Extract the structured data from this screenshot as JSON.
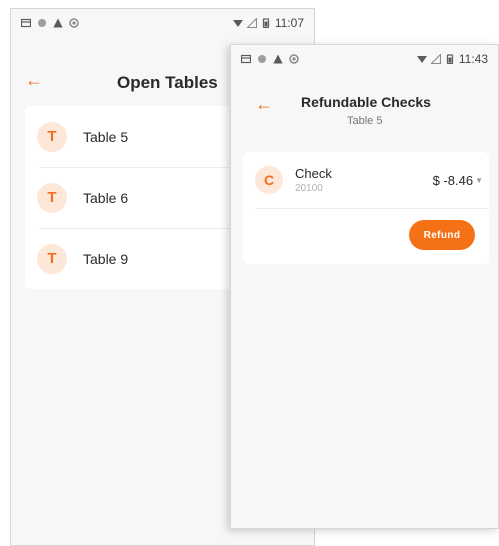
{
  "colors": {
    "accent": "#f26f21",
    "avatar_bg": "#fde7d8",
    "background": "#f7f7f7"
  },
  "back_screen": {
    "status_bar": {
      "time": "11:07"
    },
    "header": {
      "title": "Open Tables"
    },
    "tables": [
      {
        "initial": "T",
        "label": "Table 5"
      },
      {
        "initial": "T",
        "label": "Table 6"
      },
      {
        "initial": "T",
        "label": "Table 9"
      }
    ]
  },
  "front_screen": {
    "status_bar": {
      "time": "11:43"
    },
    "header": {
      "title": "Refundable Checks",
      "subtitle": "Table 5"
    },
    "checks": [
      {
        "initial": "C",
        "name": "Check",
        "number": "20100",
        "amount": "$ -8.46"
      }
    ],
    "refund_label": "Refund"
  }
}
